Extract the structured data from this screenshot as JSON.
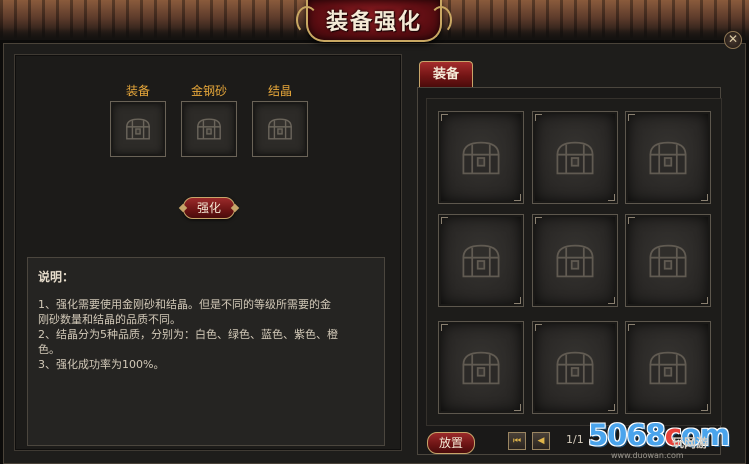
{
  "window": {
    "title": "装备强化",
    "close_symbol": "✕"
  },
  "left": {
    "slots": [
      {
        "label": "装备",
        "icon": "chest-icon"
      },
      {
        "label": "金钢砂",
        "icon": "chest-icon"
      },
      {
        "label": "结晶",
        "icon": "chest-icon"
      }
    ],
    "strengthen_button": "强化",
    "description": {
      "title": "说明：",
      "lines": [
        "1、强化需要使用金刚砂和结晶。但是不同的等级所需要的金",
        "刚砂数量和结晶的品质不同。",
        "2、结晶分为5种品质，分别为：白色、绿色、蓝色、紫色、橙",
        "色。",
        "3、强化成功率为100%。"
      ]
    }
  },
  "right": {
    "tab_label": "装备",
    "grid_slot_count": 9,
    "place_button": "放置",
    "first_page_symbol": "⏮",
    "prev_page_symbol": "◀",
    "page_indicator": "1/1"
  },
  "watermark": {
    "brand_part1": "5068",
    "brand_part2": "c",
    "brand_part3": "om",
    "domain": "www.duowan.com",
    "cn": "玩网游"
  },
  "colors": {
    "accent_red": "#8b1d22",
    "gold_border": "#c9a863",
    "label_orange": "#e8a83a",
    "panel_bg": "#1e1d1b"
  }
}
